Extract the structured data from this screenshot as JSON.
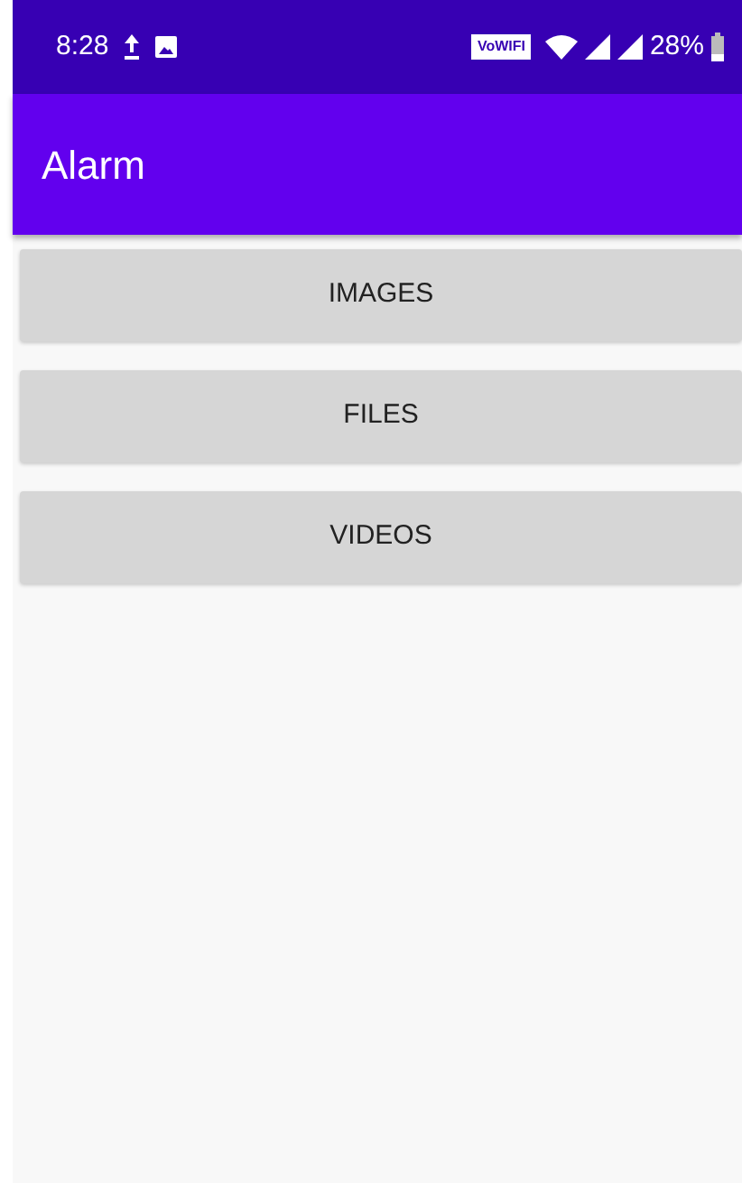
{
  "status_bar": {
    "time": "8:28",
    "wifi_calling": "VoWIFI",
    "battery": "28%"
  },
  "app_bar": {
    "title": "Alarm"
  },
  "buttons": [
    {
      "label": "IMAGES"
    },
    {
      "label": "FILES"
    },
    {
      "label": "VIDEOS"
    }
  ]
}
